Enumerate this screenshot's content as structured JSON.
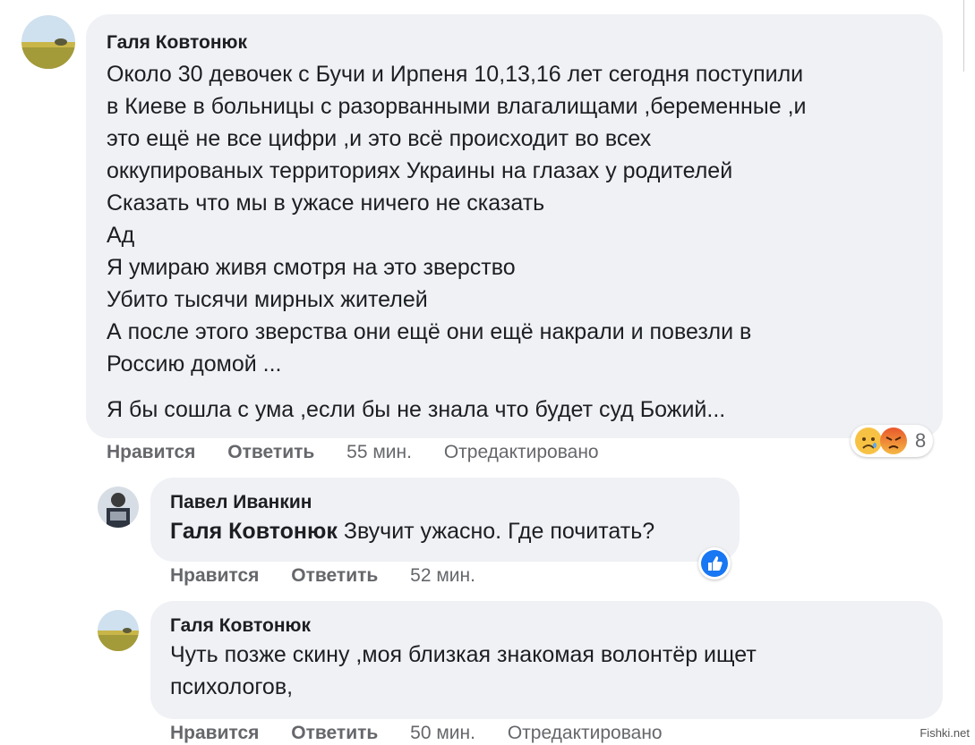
{
  "comments": [
    {
      "author": "Галя Ковтонюк",
      "lines": [
        "Около 30 девочек с Бучи и Ирпеня 10,13,16 лет сегодня поступили",
        "в Киеве в больницы с разорванными влагалищами ,беременные ,и",
        "это ещё не все цифри ,и это всё происходит во всех",
        "оккупированых территориях Украины на глазах у родителей",
        "Сказать что мы в ужасе ничего не сказать",
        "Ад",
        "Я умираю живя смотря на это зверство",
        "Убито тысячи мирных жителей",
        "А после этого зверства они ещё они ещё накрали и повезли в",
        "Россию домой ..."
      ],
      "last_line": "Я бы сошла с ума ,если бы не знала что будет суд Божий...",
      "actions": {
        "like": "Нравится",
        "reply": "Ответить",
        "time": "55 мин.",
        "edited": "Отредактировано"
      },
      "reactions": {
        "icons": [
          "sad-reaction",
          "angry-reaction"
        ],
        "count": "8"
      }
    },
    {
      "author": "Павел Иванкин",
      "mention": "Галя Ковтонюк",
      "text": "Звучит ужасно. Где почитать?",
      "actions": {
        "like": "Нравится",
        "reply": "Ответить",
        "time": "52 мин."
      },
      "reactions": {
        "icons": [
          "like-reaction"
        ]
      }
    },
    {
      "author": "Галя Ковтонюк",
      "lines": [
        "Чуть позже скину ,моя близкая знакомая волонтёр ищет",
        "психологов,"
      ],
      "actions": {
        "like": "Нравится",
        "reply": "Ответить",
        "time": "50 мин.",
        "edited": "Отредактировано"
      }
    }
  ],
  "watermark": "Fishki.net",
  "colors": {
    "bubble": "#eff1f4",
    "meta": "#65676b",
    "like_blue": "#1877f2"
  }
}
